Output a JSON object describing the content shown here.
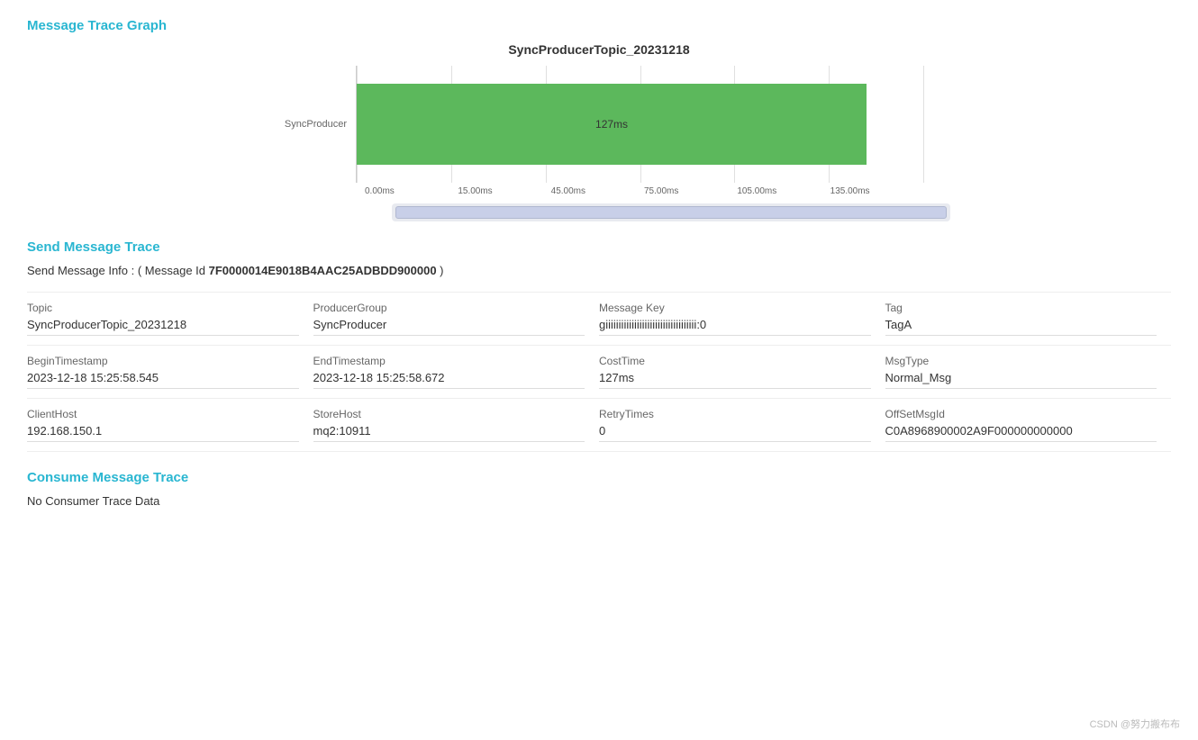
{
  "page": {
    "title": "Message Trace Graph"
  },
  "chart": {
    "title": "SyncProducerTopic_20231218",
    "y_label": "SyncProducer",
    "bar_label": "127ms",
    "bar_color": "#5cb85c",
    "x_ticks": [
      "0.00ms",
      "15.00ms",
      "45.00ms",
      "75.00ms",
      "105.00ms",
      "135.00ms"
    ],
    "bar_start_pct": 0,
    "bar_width_pct": 90
  },
  "send_trace": {
    "section_title": "Send Message Trace",
    "info_prefix": "Send Message Info : ( Message Id ",
    "message_id": "7F0000014E9018B4AAC25ADBDD900000",
    "info_suffix": " )",
    "fields": [
      {
        "label": "Topic",
        "value": "SyncProducerTopic_20231218"
      },
      {
        "label": "ProducerGroup",
        "value": "SyncProducer"
      },
      {
        "label": "Message Key",
        "value": "giiiiiiiiiiiiiiiiiiiiiiiiiiiiiiiiiii:0"
      },
      {
        "label": "Tag",
        "value": "TagA"
      },
      {
        "label": "BeginTimestamp",
        "value": "2023-12-18 15:25:58.545"
      },
      {
        "label": "EndTimestamp",
        "value": "2023-12-18 15:25:58.672"
      },
      {
        "label": "CostTime",
        "value": "127ms"
      },
      {
        "label": "MsgType",
        "value": "Normal_Msg"
      },
      {
        "label": "ClientHost",
        "value": "192.168.150.1"
      },
      {
        "label": "StoreHost",
        "value": "mq2:10911"
      },
      {
        "label": "RetryTimes",
        "value": "0"
      },
      {
        "label": "OffSetMsgId",
        "value": "C0A8968900002A9F000000000000"
      }
    ]
  },
  "consume_trace": {
    "section_title": "Consume Message Trace",
    "no_data_text": "No Consumer Trace Data"
  },
  "footer": {
    "watermark": "CSDN @努力搬布布"
  }
}
